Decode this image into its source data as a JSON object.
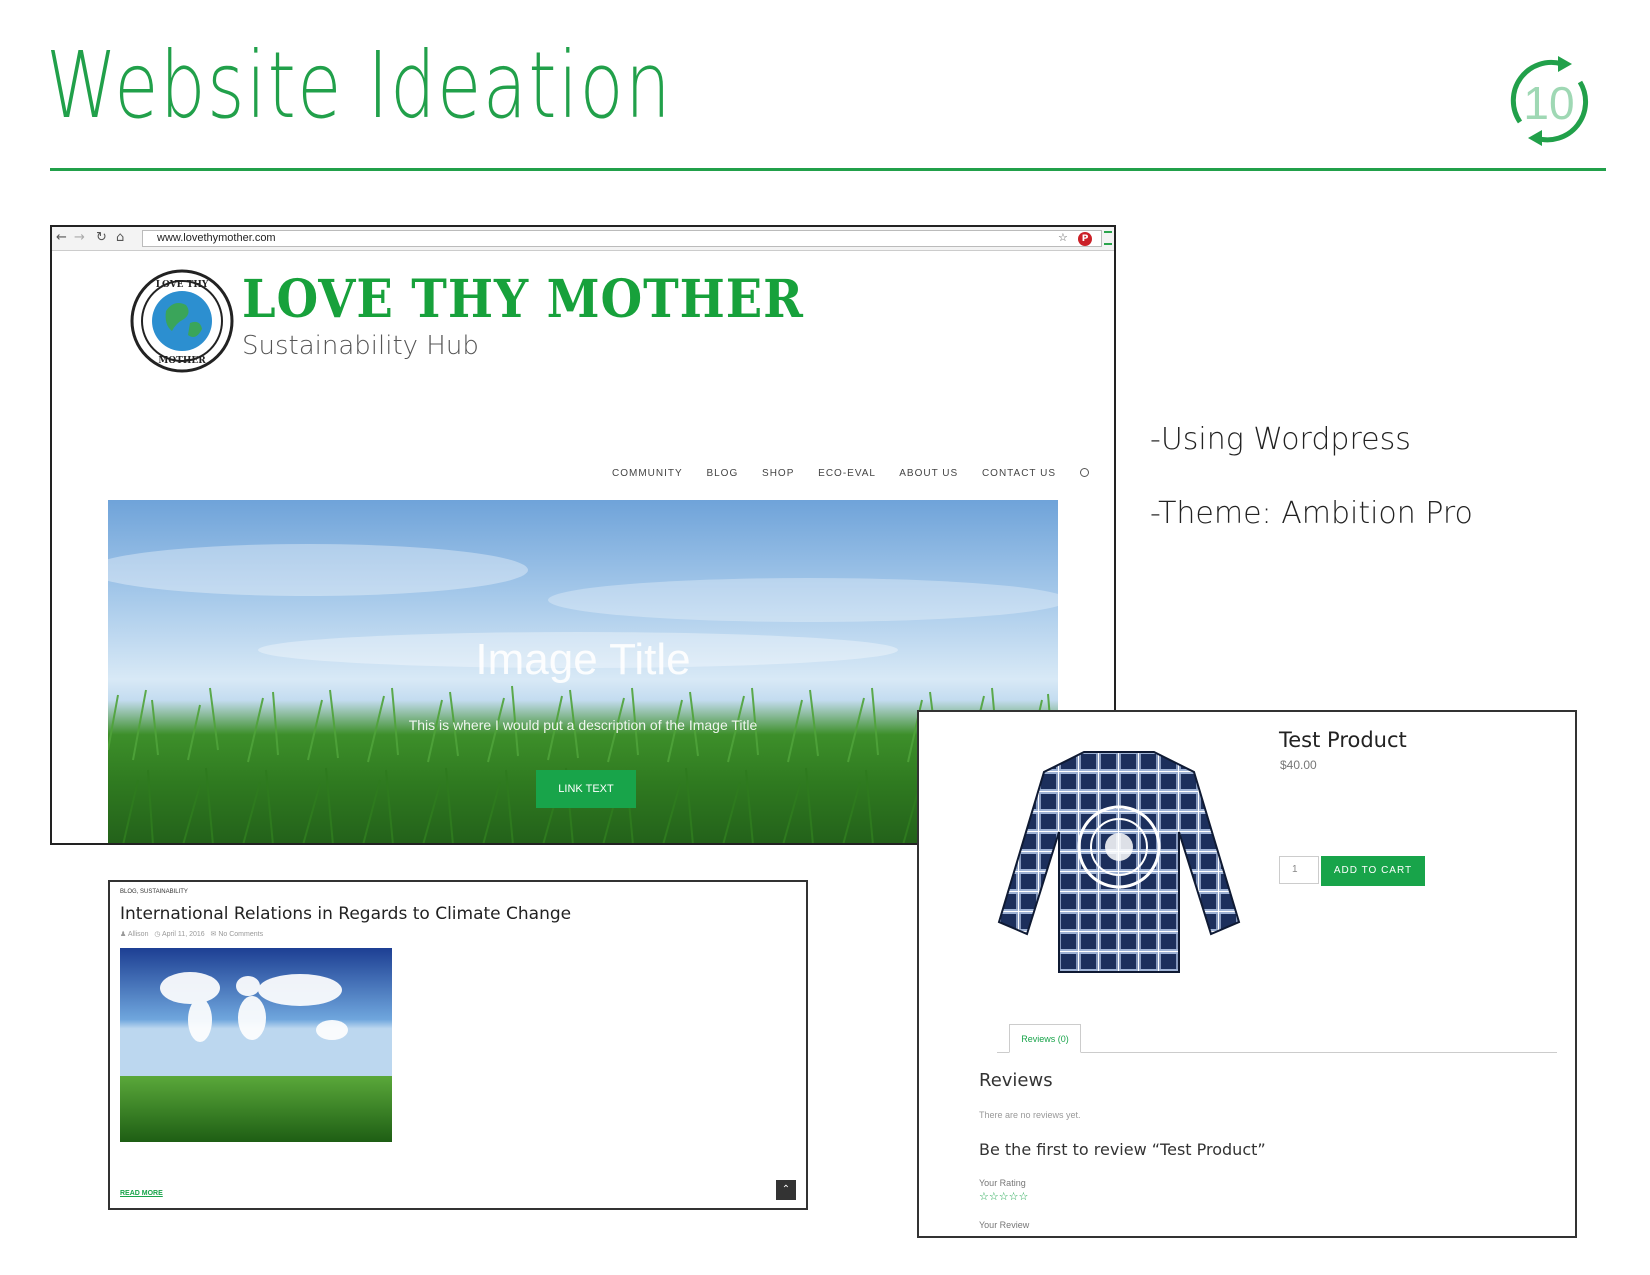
{
  "slide": {
    "title": "Website Ideation",
    "page_number": "10",
    "accent_color": "#21a04a"
  },
  "notes": [
    "-Using Wordpress",
    "-Theme: Ambition Pro"
  ],
  "browser": {
    "url": "www.lovethymother.com",
    "icons": [
      "back-arrow-icon",
      "forward-arrow-icon",
      "reload-icon",
      "home-icon",
      "bookmark-star-icon",
      "pinterest-icon",
      "menu-icon"
    ]
  },
  "site": {
    "name": "LOVE THY MOTHER",
    "tagline": "Sustainability Hub",
    "nav": [
      "COMMUNITY",
      "BLOG",
      "SHOP",
      "ECO-EVAL",
      "ABOUT US",
      "CONTACT US"
    ],
    "hero": {
      "title": "Image Title",
      "description": "This is where I would put a description of the Image Title",
      "button": "LINK TEXT"
    }
  },
  "blog": {
    "categories": "BLOG, SUSTAINABILITY",
    "title": "International Relations in Regards to Climate Change",
    "author": "Allison",
    "date": "April 11, 2016",
    "comments": "No Comments",
    "read_more": "READ MORE"
  },
  "product": {
    "name": "Test Product",
    "price": "$40.00",
    "quantity": "1",
    "add_to_cart": "ADD TO CART",
    "tab": "Reviews (0)",
    "reviews_heading": "Reviews",
    "no_reviews": "There are no reviews yet.",
    "first_review": "Be the first to review “Test Product”",
    "your_rating": "Your Rating",
    "your_review": "Your Review",
    "rating_stars": "☆☆☆☆☆"
  }
}
